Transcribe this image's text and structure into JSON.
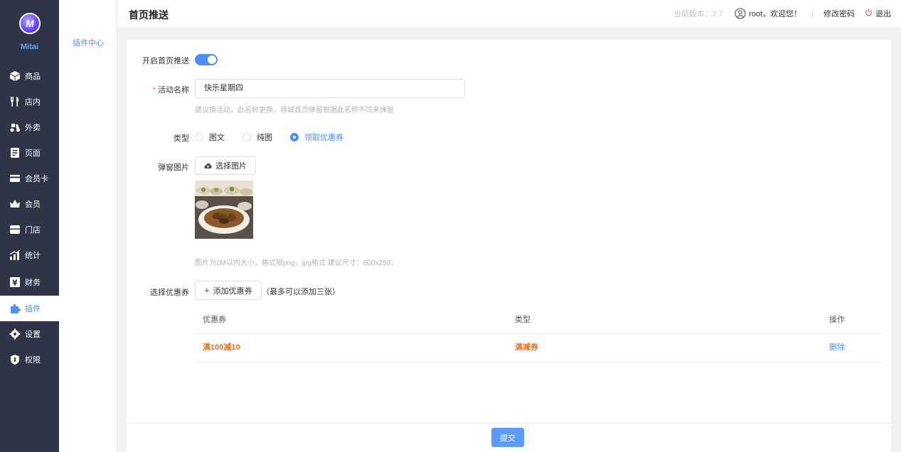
{
  "brand": {
    "logo_text": "M",
    "name": "Mitai"
  },
  "nav": [
    {
      "label": "商品",
      "icon": "box-icon"
    },
    {
      "label": "店内",
      "icon": "fork-knife-icon"
    },
    {
      "label": "外卖",
      "icon": "scooter-icon"
    },
    {
      "label": "页面",
      "icon": "page-icon"
    },
    {
      "label": "会员卡",
      "icon": "card-icon"
    },
    {
      "label": "会员",
      "icon": "crown-icon"
    },
    {
      "label": "门店",
      "icon": "store-icon"
    },
    {
      "label": "统计",
      "icon": "chart-icon"
    },
    {
      "label": "财务",
      "icon": "finance-icon"
    },
    {
      "label": "插件",
      "icon": "puzzle-icon",
      "active": true
    },
    {
      "label": "设置",
      "icon": "gear-icon"
    },
    {
      "label": "权限",
      "icon": "shield-icon"
    }
  ],
  "subnav": {
    "item": "插件中心"
  },
  "header": {
    "title": "首页推送",
    "version": "当前版本：2.7",
    "welcome": "root，欢迎您！",
    "sep": "|",
    "change_password": "修改密码",
    "logout": "退出"
  },
  "form": {
    "enable_label": "开启首页推送",
    "enabled": true,
    "name_label": "活动名称",
    "name_required_mark": "*",
    "name_value": "快乐星期四",
    "name_hint": "建议换活动，此名称更换，商城首页弹窗根据此名称不同来弹窗",
    "type_label": "类型",
    "type_options": [
      "图文",
      "纯图",
      "领取优惠券"
    ],
    "type_selected": "领取优惠券",
    "image_label": "弹窗图片",
    "choose_image": "选择图片",
    "image_hint": "图片为2M以内大小，格式限png，jpg格式 建议尺寸：600x250；",
    "coupon_label": "选择优惠券",
    "add_coupon": "添加优惠券",
    "add_coupon_note": "（最多可以添加三张）"
  },
  "table": {
    "headers": [
      "优惠券",
      "类型",
      "操作"
    ],
    "rows": [
      {
        "coupon": "满100减10",
        "type": "满减券",
        "action": "删除"
      }
    ]
  },
  "submit": "提交",
  "colors": {
    "accent": "#4d8ef7",
    "nav_bg": "#2f3447",
    "orange": "#e8701a"
  }
}
